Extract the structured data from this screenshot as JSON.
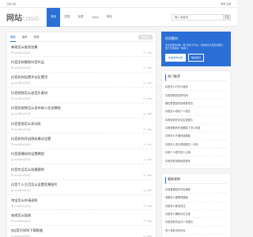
{
  "topbar": {
    "left": "万站公告",
    "right": "登录 注册"
  },
  "header": {
    "logo_main": "网站",
    "logo_sub": "LOGO",
    "nav": [
      {
        "label": "首页",
        "active": true
      },
      {
        "label": "发现",
        "active": false
      },
      {
        "label": "标签",
        "active": false
      },
      {
        "label": "TAGs",
        "active": false
      },
      {
        "label": "快传",
        "active": false
      }
    ],
    "search_placeholder": "输入关键词"
  },
  "tabs": {
    "items": [
      {
        "label": "最新",
        "active": true
      },
      {
        "label": "推荐",
        "active": false
      },
      {
        "label": "热榜",
        "active": false
      }
    ],
    "more_label": "查看更多"
  },
  "articles": [
    {
      "title": "邮政怎么查找包裹",
      "date": "2024年01月02日",
      "views": "1516"
    },
    {
      "title": "抖音怎样删除抖音作品",
      "date": "2024年01月02日",
      "views": "3630"
    },
    {
      "title": "抖音如何设置评论区置顶",
      "date": "2024年01月02日",
      "views": "1241"
    },
    {
      "title": "抖音视频怎么加音乐素材",
      "date": "2024年01月02日",
      "views": "5216"
    },
    {
      "title": "抖音短视频怎么发布新人任务教程",
      "date": "2024年01月02日",
      "views": "3080"
    },
    {
      "title": "抖音里面怎么发动态",
      "date": "2024年01月02日",
      "views": "3306"
    },
    {
      "title": "抖音如何开启隐私模式设置",
      "date": "2024年01月02日",
      "views": "4711"
    },
    {
      "title": "抖音直播如何设置教程",
      "date": "2024年01月02日",
      "views": "1029"
    },
    {
      "title": "抖音作品怎么批量删除",
      "date": "2024年01月02日",
      "views": "2816"
    },
    {
      "title": "抖音个人主页怎么设置背景图片",
      "date": "2024年01月02日",
      "views": "2316"
    },
    {
      "title": "淘宝怎么申请退款",
      "date": "2024年01月02日",
      "views": "2108"
    },
    {
      "title": "电视怎么投屏",
      "date": "2024年01月02日",
      "views": "1016"
    },
    {
      "title": "QQ音乐如何下载歌曲",
      "date": "2024年01月02日",
      "views": "2816"
    }
  ],
  "promo": {
    "title": "优质题材",
    "text": "专业优质的内容，热门的分享平台，并提供长久稳定的服务，致力于帮助每一位用户。",
    "btn_primary": "快速发布内容",
    "btn_secondary": "联系我们"
  },
  "hot": {
    "title": "热门推荐",
    "items": [
      "抖音怎么打开小程序",
      "抖音视频的发布时间",
      "微信群里如何查看群成员",
      "抖音怎么修改个人签名",
      "抖音如何在评论区发图片",
      "抖音视频的作品删除了怎么恢复",
      "抖音怎么开通商品橱窗",
      "抖音怎么发长视频超过一分钟",
      "抖音个人账号怎么注销",
      "抖音怎样设置私密账号"
    ]
  },
  "latest": {
    "title": "最新更新",
    "items": [
      "抖音直播如何开启美颜",
      "电脑怎么截屏快捷键",
      "抖音怎么取消关注",
      "抖音怎么删除评论记录",
      "抖音如何开启青少年模式",
      "怎么查看手机内存"
    ]
  }
}
